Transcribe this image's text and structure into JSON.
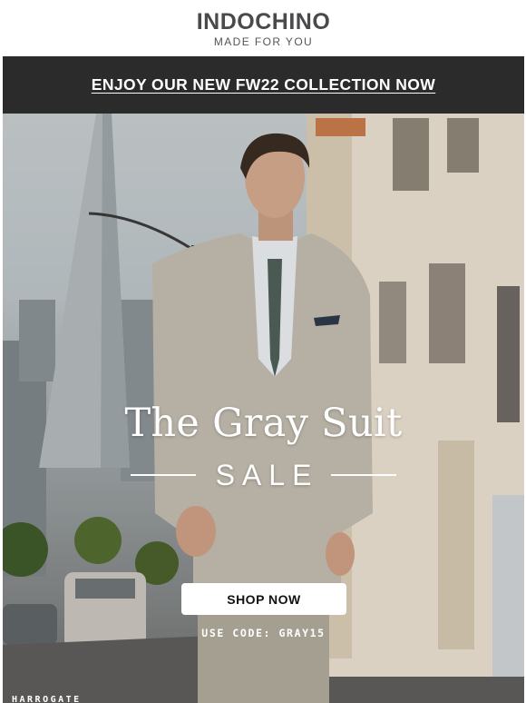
{
  "header": {
    "logo": "INDOCHINO",
    "tagline": "MADE FOR YOU"
  },
  "promo_bar": {
    "link_text": "ENJOY OUR NEW FW22 COLLECTION NOW"
  },
  "hero": {
    "title": "The Gray Suit",
    "subtitle": "SALE",
    "cta_label": "SHOP NOW",
    "promo_code_text": "USE CODE: GRAY15",
    "product_label": "HARROGATE"
  },
  "colors": {
    "promo_bar_bg": "#2b2b2b",
    "logo": "#4a4a4c",
    "button_bg": "#ffffff",
    "hero_text": "#ffffff"
  }
}
